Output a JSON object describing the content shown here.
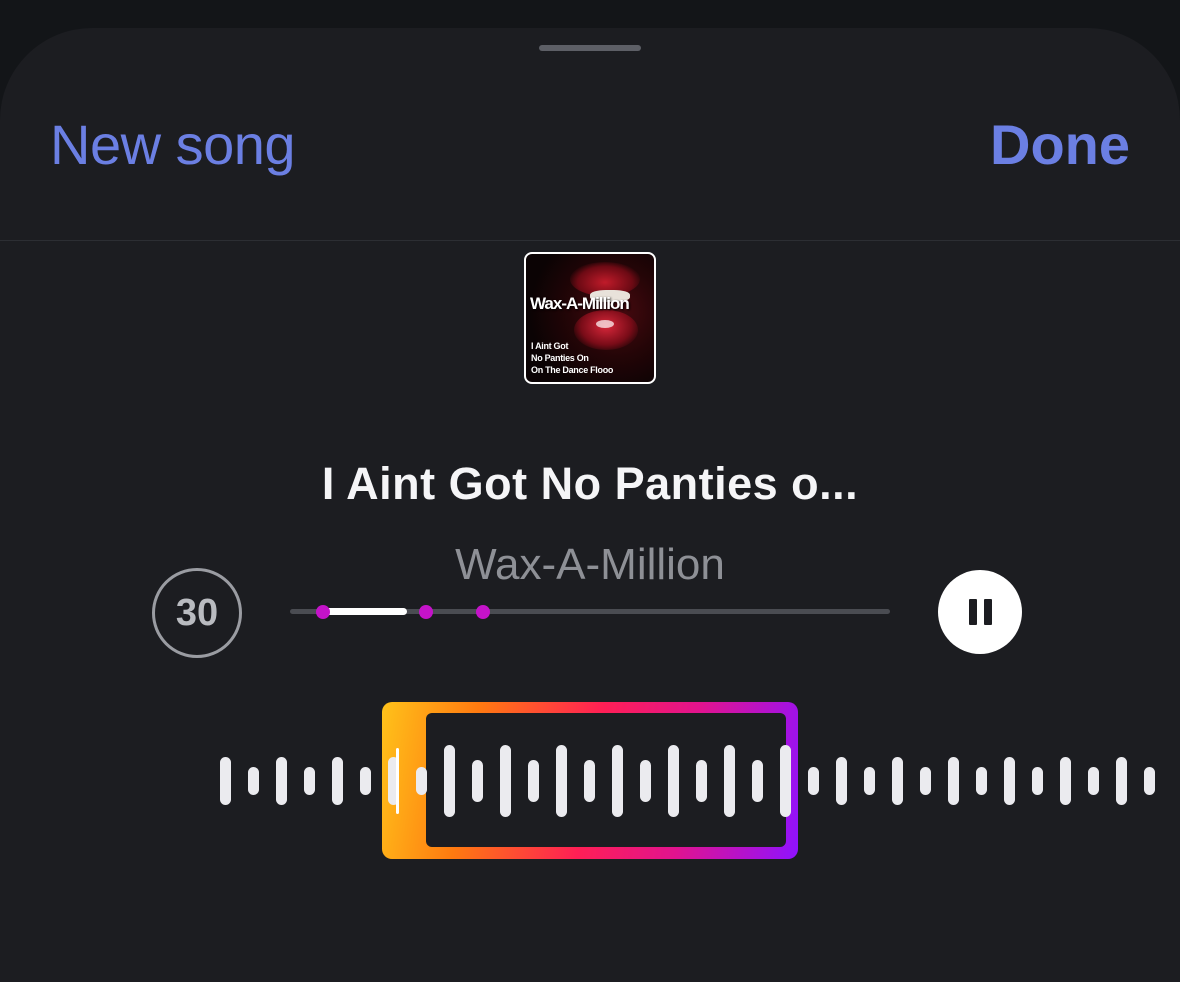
{
  "header": {
    "left_action": "New song",
    "right_action": "Done"
  },
  "album_cover": {
    "title_text": "Wax-A-Million",
    "subtitle_text": "I Aint Got\nNo Panties On\nOn The Dance Flooo"
  },
  "song": {
    "title": "I Aint Got No Panties o...",
    "artist": "Wax-A-Million"
  },
  "controls": {
    "skip_seconds": "30",
    "state": "playing"
  },
  "colors": {
    "accent": "#6b7fe3",
    "marker": "#c413c9",
    "gradient": [
      "#ffc21a",
      "#ff7a10",
      "#ff1f55",
      "#e1138e",
      "#8f12ff"
    ]
  },
  "icons": {
    "skip": "skip-30-icon",
    "pause": "pause-icon"
  }
}
